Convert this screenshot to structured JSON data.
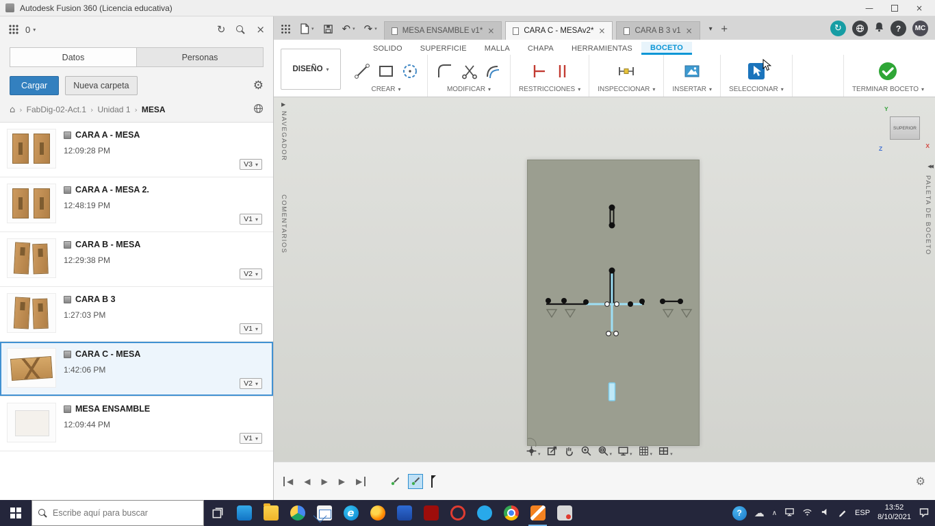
{
  "icons": {
    "dropdown": "▾",
    "close": "×",
    "refresh": "↻",
    "gear": "⚙",
    "home": "⌂",
    "undo": "↶",
    "redo": "↷",
    "sync": "↻",
    "help": "?",
    "plus": "+",
    "minimize": "—",
    "breadcrumb_sep": "›",
    "collapse": "◀◀",
    "expand": "▶",
    "back": "◀",
    "play": "▶",
    "chevron_up": "∧",
    "tab_list": "▾"
  },
  "titlebar": {
    "title": "Autodesk Fusion 360 (Licencia educativa)"
  },
  "data_panel": {
    "job_count": "0",
    "tabs": [
      {
        "label": "Datos"
      },
      {
        "label": "Personas"
      }
    ],
    "upload_button": "Cargar",
    "new_folder_button": "Nueva carpeta",
    "breadcrumb": {
      "root": "FabDig-02-Act.1",
      "middle": "Unidad 1",
      "current": "MESA"
    },
    "items": [
      {
        "name": "CARA A - MESA",
        "time": "12:09:28 PM",
        "version": "V3"
      },
      {
        "name": "CARA A - MESA 2.",
        "time": "12:48:19 PM",
        "version": "V1"
      },
      {
        "name": "CARA B - MESA",
        "time": "12:29:38 PM",
        "version": "V2"
      },
      {
        "name": "CARA B 3",
        "time": "1:27:03 PM",
        "version": "V1"
      },
      {
        "name": "CARA C - MESA",
        "time": "1:42:06 PM",
        "version": "V2"
      },
      {
        "name": "MESA ENSAMBLE",
        "time": "12:09:44 PM",
        "version": "V1"
      }
    ]
  },
  "document_tabs": {
    "tabs": [
      {
        "label": "MESA ENSAMBLE v1*"
      },
      {
        "label": "CARA C - MESAv2*"
      },
      {
        "label": "CARA B 3 v1"
      }
    ],
    "avatar": "MC"
  },
  "ribbon": {
    "workspace": "DISEÑO",
    "menu_tabs": [
      "SOLIDO",
      "SUPERFICIE",
      "MALLA",
      "CHAPA",
      "HERRAMIENTAS",
      "BOCETO"
    ],
    "groups": [
      "CREAR",
      "MODIFICAR",
      "RESTRICCIONES",
      "INSPECCIONAR",
      "INSERTAR",
      "SELECCIONAR"
    ],
    "finish_button": "TERMINAR BOCETO"
  },
  "canvas": {
    "left_tab_top": "NAVEGADOR",
    "left_tab_bottom": "COMENTARIOS",
    "right_tab": "PALETA DE BOCETO",
    "viewcube_face": "SUPERIOR",
    "axes": {
      "x": "X",
      "y": "Y",
      "z": "Z"
    }
  },
  "taskbar": {
    "search_placeholder": "Escribe aquí para buscar",
    "language": "ESP",
    "time": "13:52",
    "date": "8/10/2021"
  }
}
